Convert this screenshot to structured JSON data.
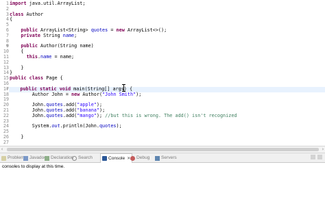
{
  "editor": {
    "lines": [
      {
        "n": "1",
        "segs": [
          {
            "t": "import",
            "c": "kw"
          },
          {
            "t": " java.util.ArrayList;",
            "c": ""
          }
        ]
      },
      {
        "n": "2",
        "segs": []
      },
      {
        "n": "3",
        "segs": [
          {
            "t": "class",
            "c": "kw"
          },
          {
            "t": " Author",
            "c": ""
          }
        ]
      },
      {
        "n": "4",
        "segs": [
          {
            "t": "{",
            "c": ""
          }
        ]
      },
      {
        "n": "5",
        "segs": []
      },
      {
        "n": "6",
        "segs": [
          {
            "t": "    ",
            "c": ""
          },
          {
            "t": "public",
            "c": "kw"
          },
          {
            "t": " ArrayList<String> ",
            "c": ""
          },
          {
            "t": "quotes",
            "c": "fld"
          },
          {
            "t": " = ",
            "c": ""
          },
          {
            "t": "new",
            "c": "kw"
          },
          {
            "t": " ArrayList<>();",
            "c": ""
          }
        ]
      },
      {
        "n": "7",
        "segs": [
          {
            "t": "    ",
            "c": ""
          },
          {
            "t": "private",
            "c": "kw"
          },
          {
            "t": " String ",
            "c": ""
          },
          {
            "t": "name",
            "c": "fld"
          },
          {
            "t": ";",
            "c": ""
          }
        ]
      },
      {
        "n": "8",
        "segs": []
      },
      {
        "n": "9",
        "fold": true,
        "segs": [
          {
            "t": "    ",
            "c": ""
          },
          {
            "t": "public",
            "c": "kw"
          },
          {
            "t": " Author(String name)",
            "c": ""
          }
        ]
      },
      {
        "n": "10",
        "segs": [
          {
            "t": "    {",
            "c": ""
          }
        ]
      },
      {
        "n": "11",
        "segs": [
          {
            "t": "      ",
            "c": ""
          },
          {
            "t": "this",
            "c": "kw"
          },
          {
            "t": ".",
            "c": ""
          },
          {
            "t": "name",
            "c": "fld"
          },
          {
            "t": " = name;",
            "c": ""
          }
        ]
      },
      {
        "n": "12",
        "segs": []
      },
      {
        "n": "13",
        "segs": [
          {
            "t": "    }",
            "c": ""
          }
        ]
      },
      {
        "n": "14",
        "segs": [
          {
            "t": "}",
            "c": ""
          }
        ]
      },
      {
        "n": "15",
        "segs": [
          {
            "t": "public",
            "c": "kw"
          },
          {
            "t": " ",
            "c": ""
          },
          {
            "t": "class",
            "c": "kw"
          },
          {
            "t": " Page {",
            "c": ""
          }
        ]
      },
      {
        "n": "16",
        "segs": []
      },
      {
        "n": "17",
        "fold": true,
        "hl": true,
        "segs": [
          {
            "t": "    ",
            "c": ""
          },
          {
            "t": "public",
            "c": "kw"
          },
          {
            "t": " ",
            "c": ""
          },
          {
            "t": "static",
            "c": "kw"
          },
          {
            "t": " ",
            "c": ""
          },
          {
            "t": "void",
            "c": "kw"
          },
          {
            "t": " main(String[] args) {",
            "c": ""
          }
        ]
      },
      {
        "n": "18",
        "segs": [
          {
            "t": "        Author John = ",
            "c": ""
          },
          {
            "t": "new",
            "c": "kw"
          },
          {
            "t": " Author(",
            "c": ""
          },
          {
            "t": "\"John Smith\"",
            "c": "str"
          },
          {
            "t": ");",
            "c": ""
          }
        ]
      },
      {
        "n": "19",
        "segs": []
      },
      {
        "n": "20",
        "segs": [
          {
            "t": "        John.",
            "c": ""
          },
          {
            "t": "quotes",
            "c": "fld"
          },
          {
            "t": ".add(",
            "c": ""
          },
          {
            "t": "\"apple\"",
            "c": "str"
          },
          {
            "t": ");",
            "c": ""
          }
        ]
      },
      {
        "n": "21",
        "segs": [
          {
            "t": "        John.",
            "c": ""
          },
          {
            "t": "quotes",
            "c": "fld"
          },
          {
            "t": ".add(",
            "c": ""
          },
          {
            "t": "\"banana\"",
            "c": "str"
          },
          {
            "t": ");",
            "c": ""
          }
        ]
      },
      {
        "n": "22",
        "segs": [
          {
            "t": "        John.",
            "c": ""
          },
          {
            "t": "quotes",
            "c": "fld"
          },
          {
            "t": ".add(",
            "c": ""
          },
          {
            "t": "\"mango\"",
            "c": "str"
          },
          {
            "t": "); ",
            "c": ""
          },
          {
            "t": "//but this is wrong. The add() isn't recognized",
            "c": "cmt"
          }
        ]
      },
      {
        "n": "23",
        "segs": []
      },
      {
        "n": "24",
        "segs": [
          {
            "t": "        System.",
            "c": ""
          },
          {
            "t": "out",
            "c": "fld it"
          },
          {
            "t": ".println(John.",
            "c": ""
          },
          {
            "t": "quotes",
            "c": "fld"
          },
          {
            "t": ");",
            "c": ""
          }
        ]
      },
      {
        "n": "25",
        "segs": []
      },
      {
        "n": "26",
        "segs": [
          {
            "t": "    }",
            "c": ""
          }
        ]
      },
      {
        "n": "27",
        "segs": []
      }
    ]
  },
  "tabs": [
    {
      "label": "Problems",
      "icon": "problems-icon",
      "cls": "problems",
      "active": false
    },
    {
      "label": "Javadoc",
      "icon": "javadoc-icon",
      "cls": "javadoc",
      "active": false
    },
    {
      "label": "Declaration",
      "icon": "declaration-icon",
      "cls": "decl",
      "active": false
    },
    {
      "label": "Search",
      "icon": "search-icon",
      "cls": "search",
      "active": false
    },
    {
      "label": "Console",
      "icon": "console-icon",
      "cls": "console",
      "active": true
    },
    {
      "label": "Debug",
      "icon": "debug-icon",
      "cls": "debug",
      "active": false
    },
    {
      "label": "Servers",
      "icon": "servers-icon",
      "cls": "servers",
      "active": false
    }
  ],
  "console": {
    "message": "consoles to display at this time."
  }
}
